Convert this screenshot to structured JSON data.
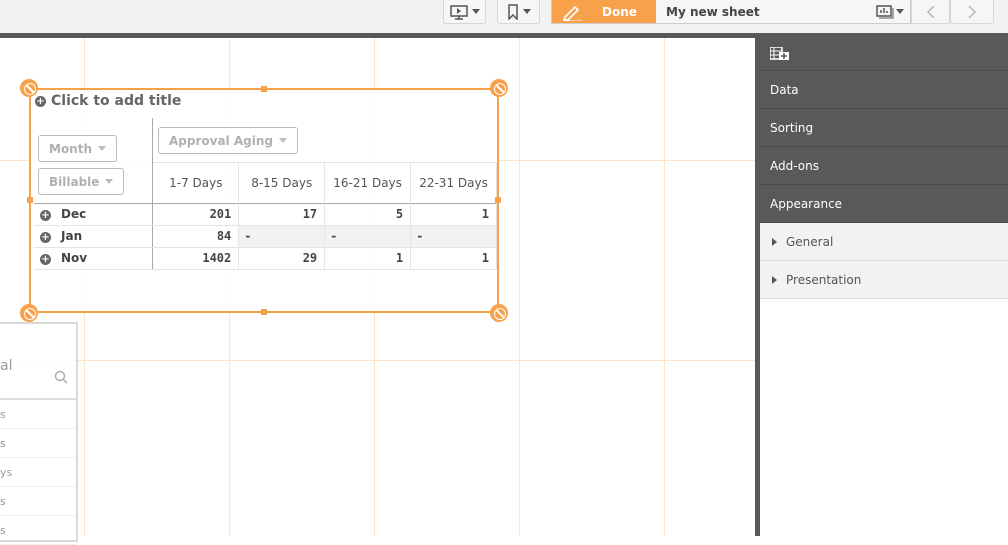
{
  "toolbar": {
    "present_icon": "presentation-icon",
    "bookmark_icon": "bookmark-icon",
    "done_label": "Done",
    "sheet_name": "My new sheet",
    "sheet_icon": "sheets-icon",
    "prev_icon": "chevron-left-icon",
    "next_icon": "chevron-right-icon"
  },
  "colors": {
    "accent": "#f8a14b",
    "panel_dark": "#595959"
  },
  "object": {
    "title_placeholder": "Click to add title",
    "row_dims": [
      "Month",
      "Billable"
    ],
    "col_dim": "Approval Aging",
    "columns": [
      "1-7 Days",
      "8-15 Days",
      "16-21 Days",
      "22-31 Days"
    ],
    "rows": [
      {
        "label": "Dec",
        "values": [
          "201",
          "17",
          "5",
          "1"
        ]
      },
      {
        "label": "Jan",
        "values": [
          "84",
          "-",
          "-",
          "-"
        ]
      },
      {
        "label": "Nov",
        "values": [
          "1402",
          "29",
          "1",
          "1"
        ]
      }
    ]
  },
  "listbox": {
    "title_fragment": "al",
    "items": [
      "s",
      "s",
      "ys",
      "s",
      "s"
    ]
  },
  "panel": {
    "header_icon": "add-table-icon",
    "sections": [
      "Data",
      "Sorting",
      "Add-ons",
      "Appearance"
    ],
    "subsections": [
      "General",
      "Presentation"
    ]
  }
}
